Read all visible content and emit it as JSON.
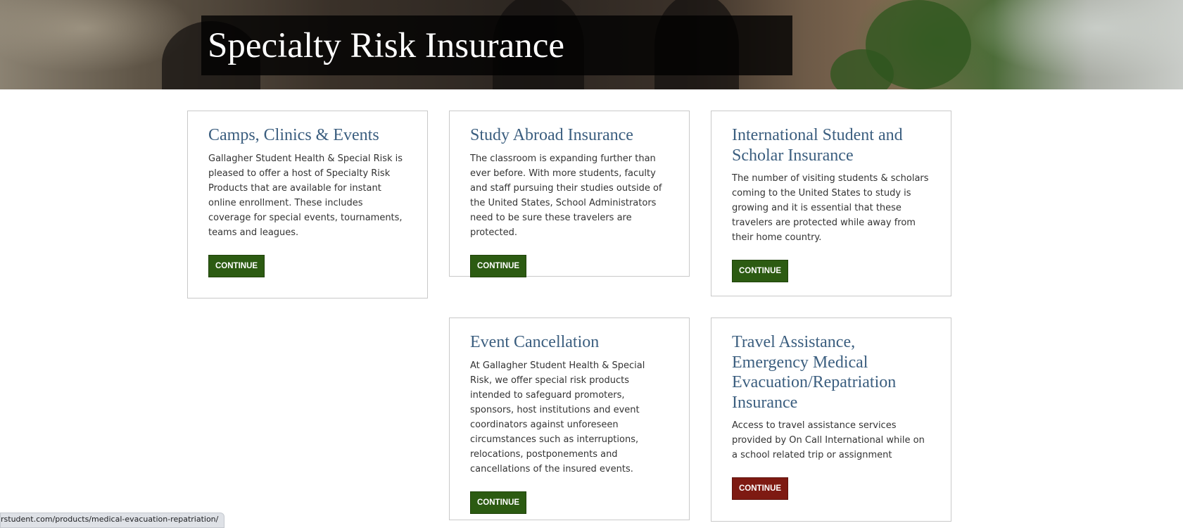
{
  "hero": {
    "title": "Specialty Risk Insurance"
  },
  "cards": [
    {
      "title": "Camps, Clinics & Events",
      "description": "Gallagher Student Health & Special Risk is pleased to offer a host of Specialty Risk Products that are available for instant online enrollment. These includes coverage for special events, tournaments, teams and leagues.",
      "button": "CONTINUE"
    },
    {
      "title": "Study Abroad Insurance",
      "description": "The classroom is expanding further than ever before. With more students, faculty and staff pursuing their studies outside of the United States, School Administrators need to be sure these travelers are protected.",
      "button": "CONTINUE"
    },
    {
      "title": "International Student and Scholar Insurance",
      "description": "The number of visiting students & scholars coming to the United States to study is growing and it is essential that these travelers are protected while away from their home country.",
      "button": "CONTINUE"
    },
    {
      "title": "Event Cancellation",
      "description": "At Gallagher Student Health & Special Risk, we offer special risk products intended to safeguard promoters, sponsors, host institutions and event coordinators against unforeseen circumstances such as interruptions, relocations, postponements and cancellations of the insured events.",
      "button": "CONTINUE"
    },
    {
      "title": "Travel Assistance, Emergency Medical Evacuation/Repatriation Insurance",
      "description": "Access to travel assistance services provided by On Call International while on a school related trip or assignment",
      "button": "CONTINUE"
    }
  ],
  "colors": {
    "button_green": "#2c5b12",
    "button_red": "#7e1a12",
    "heading_blue": "#3b5e7f"
  },
  "status_bar": {
    "url": "rstudent.com/products/medical-evacuation-repatriation/"
  }
}
